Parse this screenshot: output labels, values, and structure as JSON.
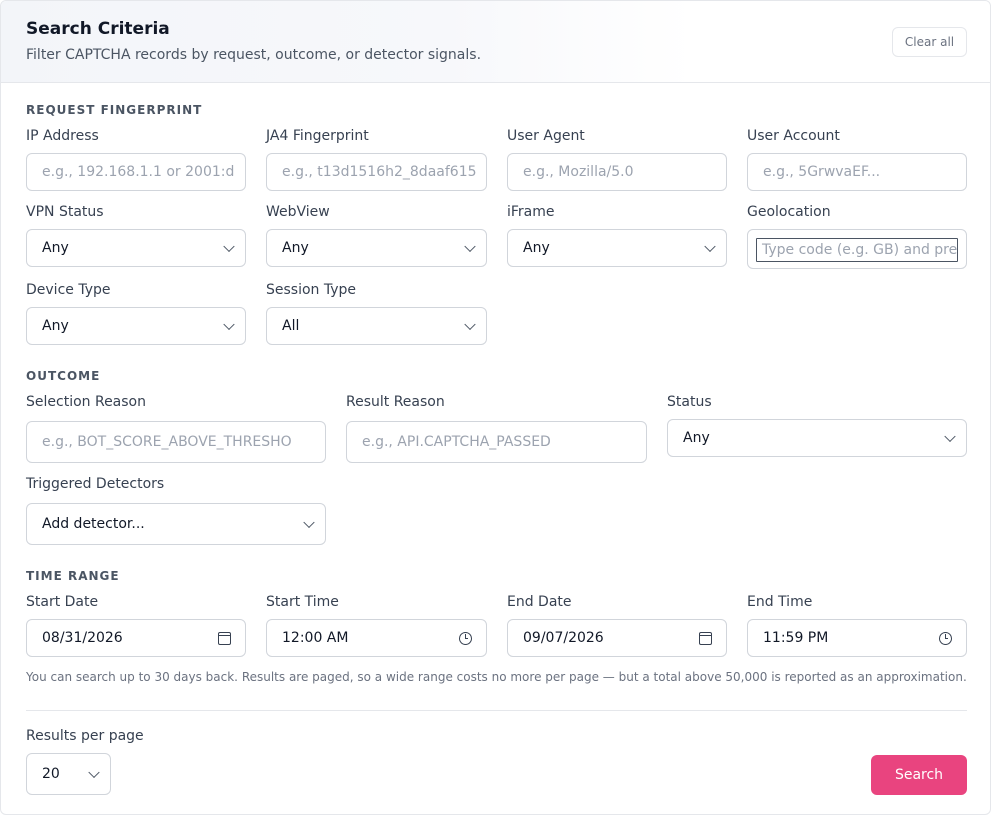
{
  "header": {
    "title": "Search Criteria",
    "subtitle": "Filter CAPTCHA records by request, outcome, or detector signals.",
    "clear_label": "Clear all"
  },
  "request_fingerprint": {
    "section_label": "REQUEST FINGERPRINT",
    "ip_address": {
      "label": "IP Address",
      "placeholder": "e.g., 192.168.1.1 or 2001:d"
    },
    "ja4": {
      "label": "JA4 Fingerprint",
      "placeholder": "e.g., t13d1516h2_8daaf615"
    },
    "user_agent": {
      "label": "User Agent",
      "placeholder": "e.g., Mozilla/5.0"
    },
    "user_account": {
      "label": "User Account",
      "placeholder": "e.g., 5GrwvaEF..."
    },
    "vpn_status": {
      "label": "VPN Status",
      "value": "Any"
    },
    "webview": {
      "label": "WebView",
      "value": "Any"
    },
    "iframe": {
      "label": "iFrame",
      "value": "Any"
    },
    "geolocation": {
      "label": "Geolocation",
      "placeholder": "Type code (e.g. GB) and pre"
    },
    "device_type": {
      "label": "Device Type",
      "value": "Any"
    },
    "session_type": {
      "label": "Session Type",
      "value": "All"
    }
  },
  "outcome": {
    "section_label": "OUTCOME",
    "selection_reason": {
      "label": "Selection Reason",
      "placeholder": "e.g., BOT_SCORE_ABOVE_THRESHO"
    },
    "result_reason": {
      "label": "Result Reason",
      "placeholder": "e.g., API.CAPTCHA_PASSED"
    },
    "status": {
      "label": "Status",
      "value": "Any"
    },
    "triggered_detectors": {
      "label": "Triggered Detectors",
      "value": "Add detector..."
    }
  },
  "time_range": {
    "section_label": "TIME RANGE",
    "start_date": {
      "label": "Start Date",
      "value": "08/31/2026"
    },
    "start_time": {
      "label": "Start Time",
      "value": "12:00 AM"
    },
    "end_date": {
      "label": "End Date",
      "value": "09/07/2026"
    },
    "end_time": {
      "label": "End Time",
      "value": "11:59 PM"
    },
    "note": "You can search up to 30 days back. Results are paged, so a wide range costs no more per page — but a total above 50,000 is reported as an approximation."
  },
  "footer": {
    "results_per_page_label": "Results per page",
    "results_per_page_value": "20",
    "search_label": "Search"
  },
  "colors": {
    "accent": "#e9447f",
    "border": "#d1d5db"
  }
}
